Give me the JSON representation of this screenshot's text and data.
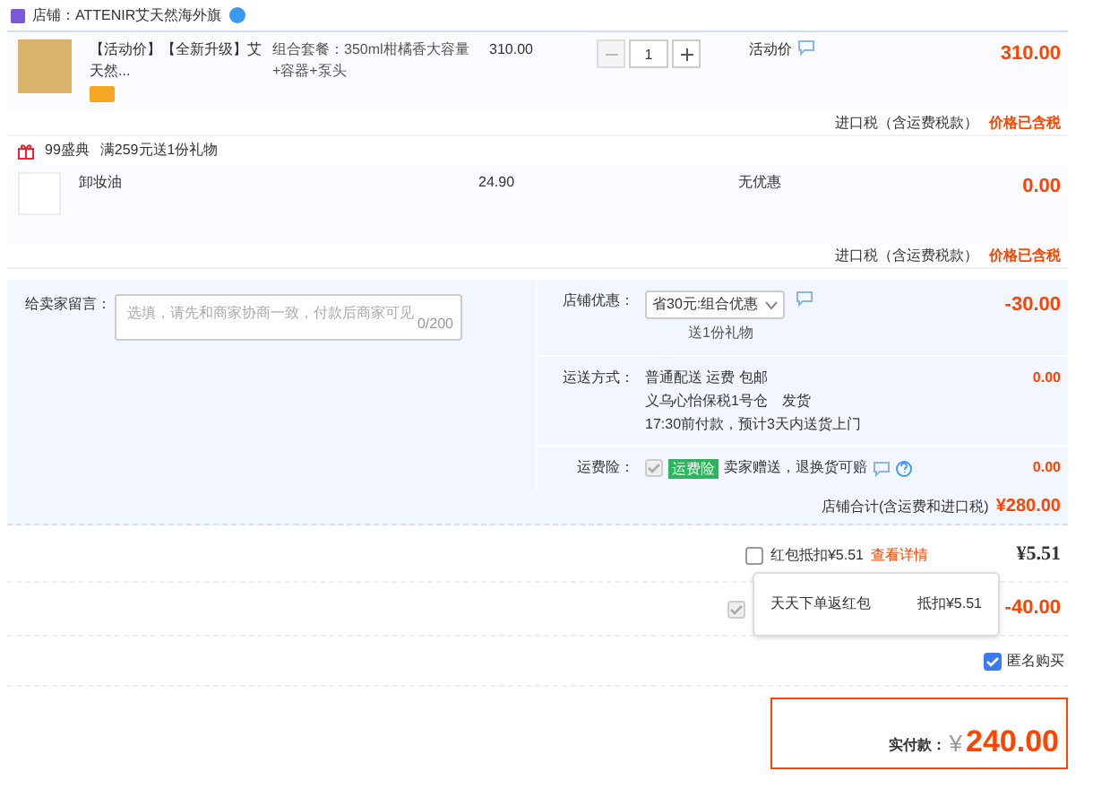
{
  "store": {
    "name": "店铺：ATTENIR艾天然海外旗"
  },
  "items": [
    {
      "kind": "main",
      "title": "【活动价】【全新升级】艾天然...",
      "spec": "组合套餐：350ml柑橘香大容量+容器+泵头",
      "unit_price": "310.00",
      "quantity": "1",
      "promo": "活动价",
      "subtotal": "310.00",
      "tax_label": "进口税（含运费税款）",
      "tax_note": "价格已含税"
    },
    {
      "kind": "gift",
      "title": "卸妆油",
      "unit_price": "24.90",
      "promo": "无优惠",
      "subtotal": "0.00",
      "tax_label": "进口税（含运费税款）",
      "tax_note": "价格已含税"
    }
  ],
  "gift_header": {
    "event": "99盛典",
    "text": "满259元送1份礼物"
  },
  "message": {
    "label": "给卖家留言：",
    "placeholder": "选填，请先和商家协商一致，付款后商家可见",
    "counter": "0/200"
  },
  "options": [
    {
      "kind": "select",
      "label": "店铺优惠：",
      "value": "省30元:组合优惠",
      "note": "送1份礼物",
      "amount": "-30.00"
    },
    {
      "kind": "lines",
      "label": "运送方式：",
      "lines": [
        "普通配送 运费 包邮",
        "义乌心怡保税1号仓　发货",
        "17:30前付款，预计3天内送货上门"
      ],
      "amount": "0.00"
    },
    {
      "kind": "check",
      "label": "运费险：",
      "checked": true,
      "disabled": true,
      "badge": "运费险",
      "text": "卖家赠送，退换货可赔",
      "amount": "0.00"
    }
  ],
  "store_total": {
    "label": "店铺合计(含运费和进口税)",
    "amount": "¥280.00"
  },
  "red_packet": {
    "checked": false,
    "label": "红包抵扣¥5.51",
    "link": "查看详情",
    "amount": "¥5.51"
  },
  "coupon": {
    "checked": true,
    "disabled": true,
    "amount": "-40.00"
  },
  "popover": {
    "name": "天天下单返红包",
    "value": "抵扣¥5.51"
  },
  "anonymous": {
    "checked": true,
    "label": "匿名购买"
  },
  "payment": {
    "label": "实付款：",
    "currency": "¥",
    "amount": "240.00"
  }
}
